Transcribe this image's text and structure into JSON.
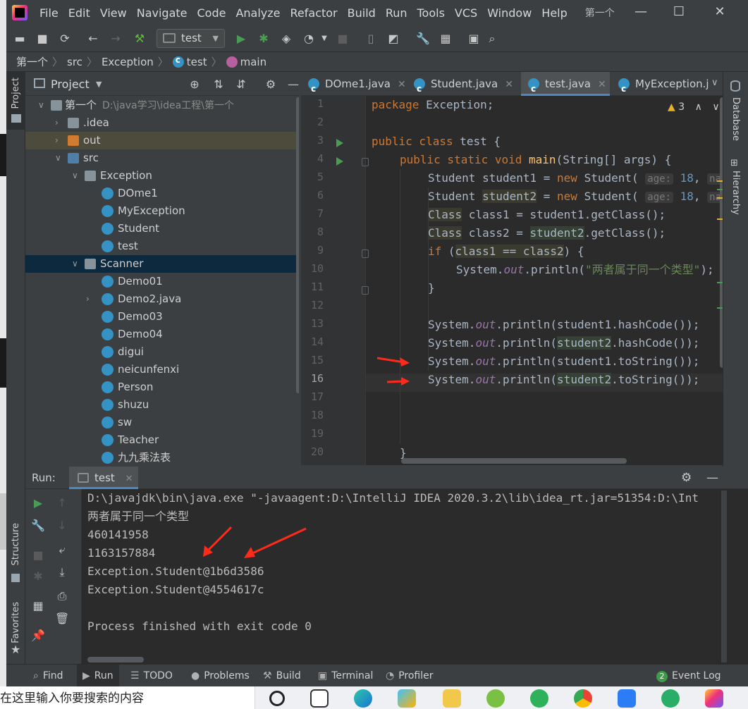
{
  "menubar": {
    "items": [
      "File",
      "Edit",
      "View",
      "Navigate",
      "Code",
      "Analyze",
      "Refactor",
      "Build",
      "Run",
      "Tools",
      "VCS",
      "Window",
      "Help"
    ],
    "project_name": "第一个"
  },
  "toolbar": {
    "run_config": "test"
  },
  "breadcrumb": {
    "items": [
      "第一个",
      "src",
      "Exception",
      "test",
      "main"
    ]
  },
  "project_panel": {
    "title": "Project",
    "root": "第一个",
    "root_path": "D:\\java学习\\idea工程\\第一个",
    "nodes": [
      ".idea",
      "out",
      "src",
      "Exception",
      "DOme1",
      "MyException",
      "Student",
      "test",
      "Scanner",
      "Demo01",
      "Demo2.java",
      "Demo03",
      "Demo04",
      "digui",
      "neicunfenxi",
      "Person",
      "shuzu",
      "sw",
      "Teacher",
      "九九乘法表"
    ]
  },
  "side_labels": {
    "project": "Project",
    "structure": "Structure",
    "favorites": "Favorites",
    "database": "Database",
    "hierarchy": "Hierarchy"
  },
  "editor": {
    "tabs": [
      "DOme1.java",
      "Student.java",
      "test.java",
      "MyException.j"
    ],
    "warning_count": "3",
    "line_numbers": [
      "1",
      "2",
      "3",
      "4",
      "5",
      "6",
      "7",
      "8",
      "9",
      "10",
      "11",
      "12",
      "13",
      "14",
      "15",
      "16",
      "17",
      "18",
      "19",
      "20"
    ],
    "code": {
      "l1a": "package",
      "l1b": " Exception;",
      "l3a": "public class",
      "l3b": " test {",
      "l4a": "public static void",
      "l4b": "main",
      "l4c": "(String[] args) {",
      "l5a": "Student ",
      "l5b": "student1",
      "l5c": " = ",
      "l5d": "new",
      "l5e": " Student( ",
      "l5f": "age:",
      "l5g": " 18",
      "l5h": ", ",
      "l5i": "nam",
      "l6a": "Student ",
      "l6b": "student2",
      "l6c": " = ",
      "l6d": "new",
      "l6e": " Student( ",
      "l6f": "age:",
      "l6g": " 18",
      "l6h": ", ",
      "l6i": "nam",
      "l7a": "Class",
      "l7b": " class1 = student1.getClass();",
      "l8a": "Class",
      "l8b": " class2 = ",
      "l8c": "student2",
      "l8d": ".getClass();",
      "l9a": "if",
      "l9b": " (",
      "l9c": "class1 == class2",
      "l9d": ") {",
      "l10a": "System.",
      "l10b": "out",
      "l10c": ".println(",
      "l10d": "\"两者属于同一个类型\"",
      "l10e": ");",
      "l11": "}",
      "l13a": "System.",
      "l13b": "out",
      "l13c": ".println(student1.hashCode());",
      "l14a": "System.",
      "l14b": "out",
      "l14c": ".println(",
      "l14d": "student2",
      "l14e": ".hashCode());",
      "l15a": "System.",
      "l15b": "out",
      "l15c": ".println(student1.toString());",
      "l16a": "System.",
      "l16b": "out",
      "l16c": ".println(",
      "l16d": "student2",
      "l16e": ".toString());",
      "l20": "}"
    }
  },
  "run_panel": {
    "label": "Run:",
    "tab": "test",
    "output": [
      "D:\\javajdk\\bin\\java.exe \"-javaagent:D:\\IntelliJ IDEA 2020.3.2\\lib\\idea_rt.jar=51354:D:\\Int",
      "两者属于同一个类型",
      "460141958",
      "1163157884",
      "Exception.Student@1b6d3586",
      "Exception.Student@4554617c",
      "",
      "Process finished with exit code 0"
    ]
  },
  "statusbar": {
    "find": "Find",
    "run": "Run",
    "todo": "TODO",
    "problems": "Problems",
    "build": "Build",
    "terminal": "Terminal",
    "profiler": "Profiler",
    "event_log": "Event Log",
    "event_count": "2"
  },
  "taskbar": {
    "search_placeholder": "在这里输入你要搜索的内容"
  },
  "colors": {
    "bg": "#2b2b2b",
    "panel": "#3c3f41",
    "keyword": "#cc7832",
    "string": "#6a8759",
    "accent": "#4a88c7",
    "arrow": "#ff2a1a"
  }
}
